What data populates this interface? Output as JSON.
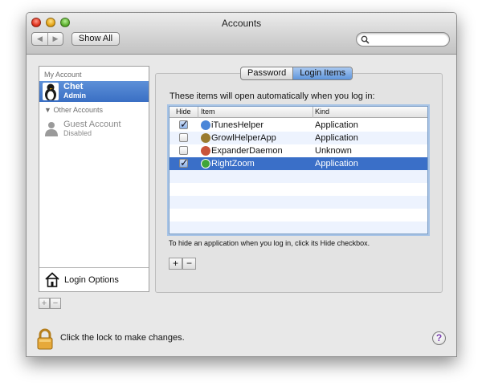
{
  "window": {
    "title": "Accounts"
  },
  "toolbar": {
    "back_icon": "back-arrow-icon",
    "forward_icon": "forward-arrow-icon",
    "show_all_label": "Show All",
    "search_placeholder": ""
  },
  "sidebar": {
    "my_account_header": "My Account",
    "current_user": {
      "name": "Chet",
      "role": "Admin"
    },
    "other_accounts_header": "Other Accounts",
    "guest": {
      "name": "Guest Account",
      "status": "Disabled"
    },
    "login_options_label": "Login Options",
    "add_label": "+",
    "remove_label": "−"
  },
  "tabs": [
    {
      "label": "Password",
      "active": false
    },
    {
      "label": "Login Items",
      "active": true
    }
  ],
  "login_items": {
    "intro": "These items will open automatically when you log in:",
    "columns": [
      "Hide",
      "Item",
      "Kind"
    ],
    "rows": [
      {
        "hide": true,
        "item": "iTunesHelper",
        "kind": "Application",
        "icon": "itunes-helper-icon",
        "color": "#4a86d8"
      },
      {
        "hide": false,
        "item": "GrowlHelperApp",
        "kind": "Application",
        "icon": "growl-icon",
        "color": "#9a7b2f"
      },
      {
        "hide": false,
        "item": "ExpanderDaemon",
        "kind": "Unknown",
        "icon": "expander-icon",
        "color": "#c9543a"
      },
      {
        "hide": true,
        "item": "RightZoom",
        "kind": "Application",
        "icon": "rightzoom-icon",
        "color": "#3fa53a",
        "selected": true
      }
    ],
    "hint": "To hide an application when you log in, click its Hide checkbox.",
    "add_label": "+",
    "remove_label": "−"
  },
  "footer": {
    "lock_text": "Click the lock to make changes.",
    "help_label": "?"
  },
  "colors": {
    "selection": "#3a6fc8",
    "help": "#7a3fb0"
  }
}
